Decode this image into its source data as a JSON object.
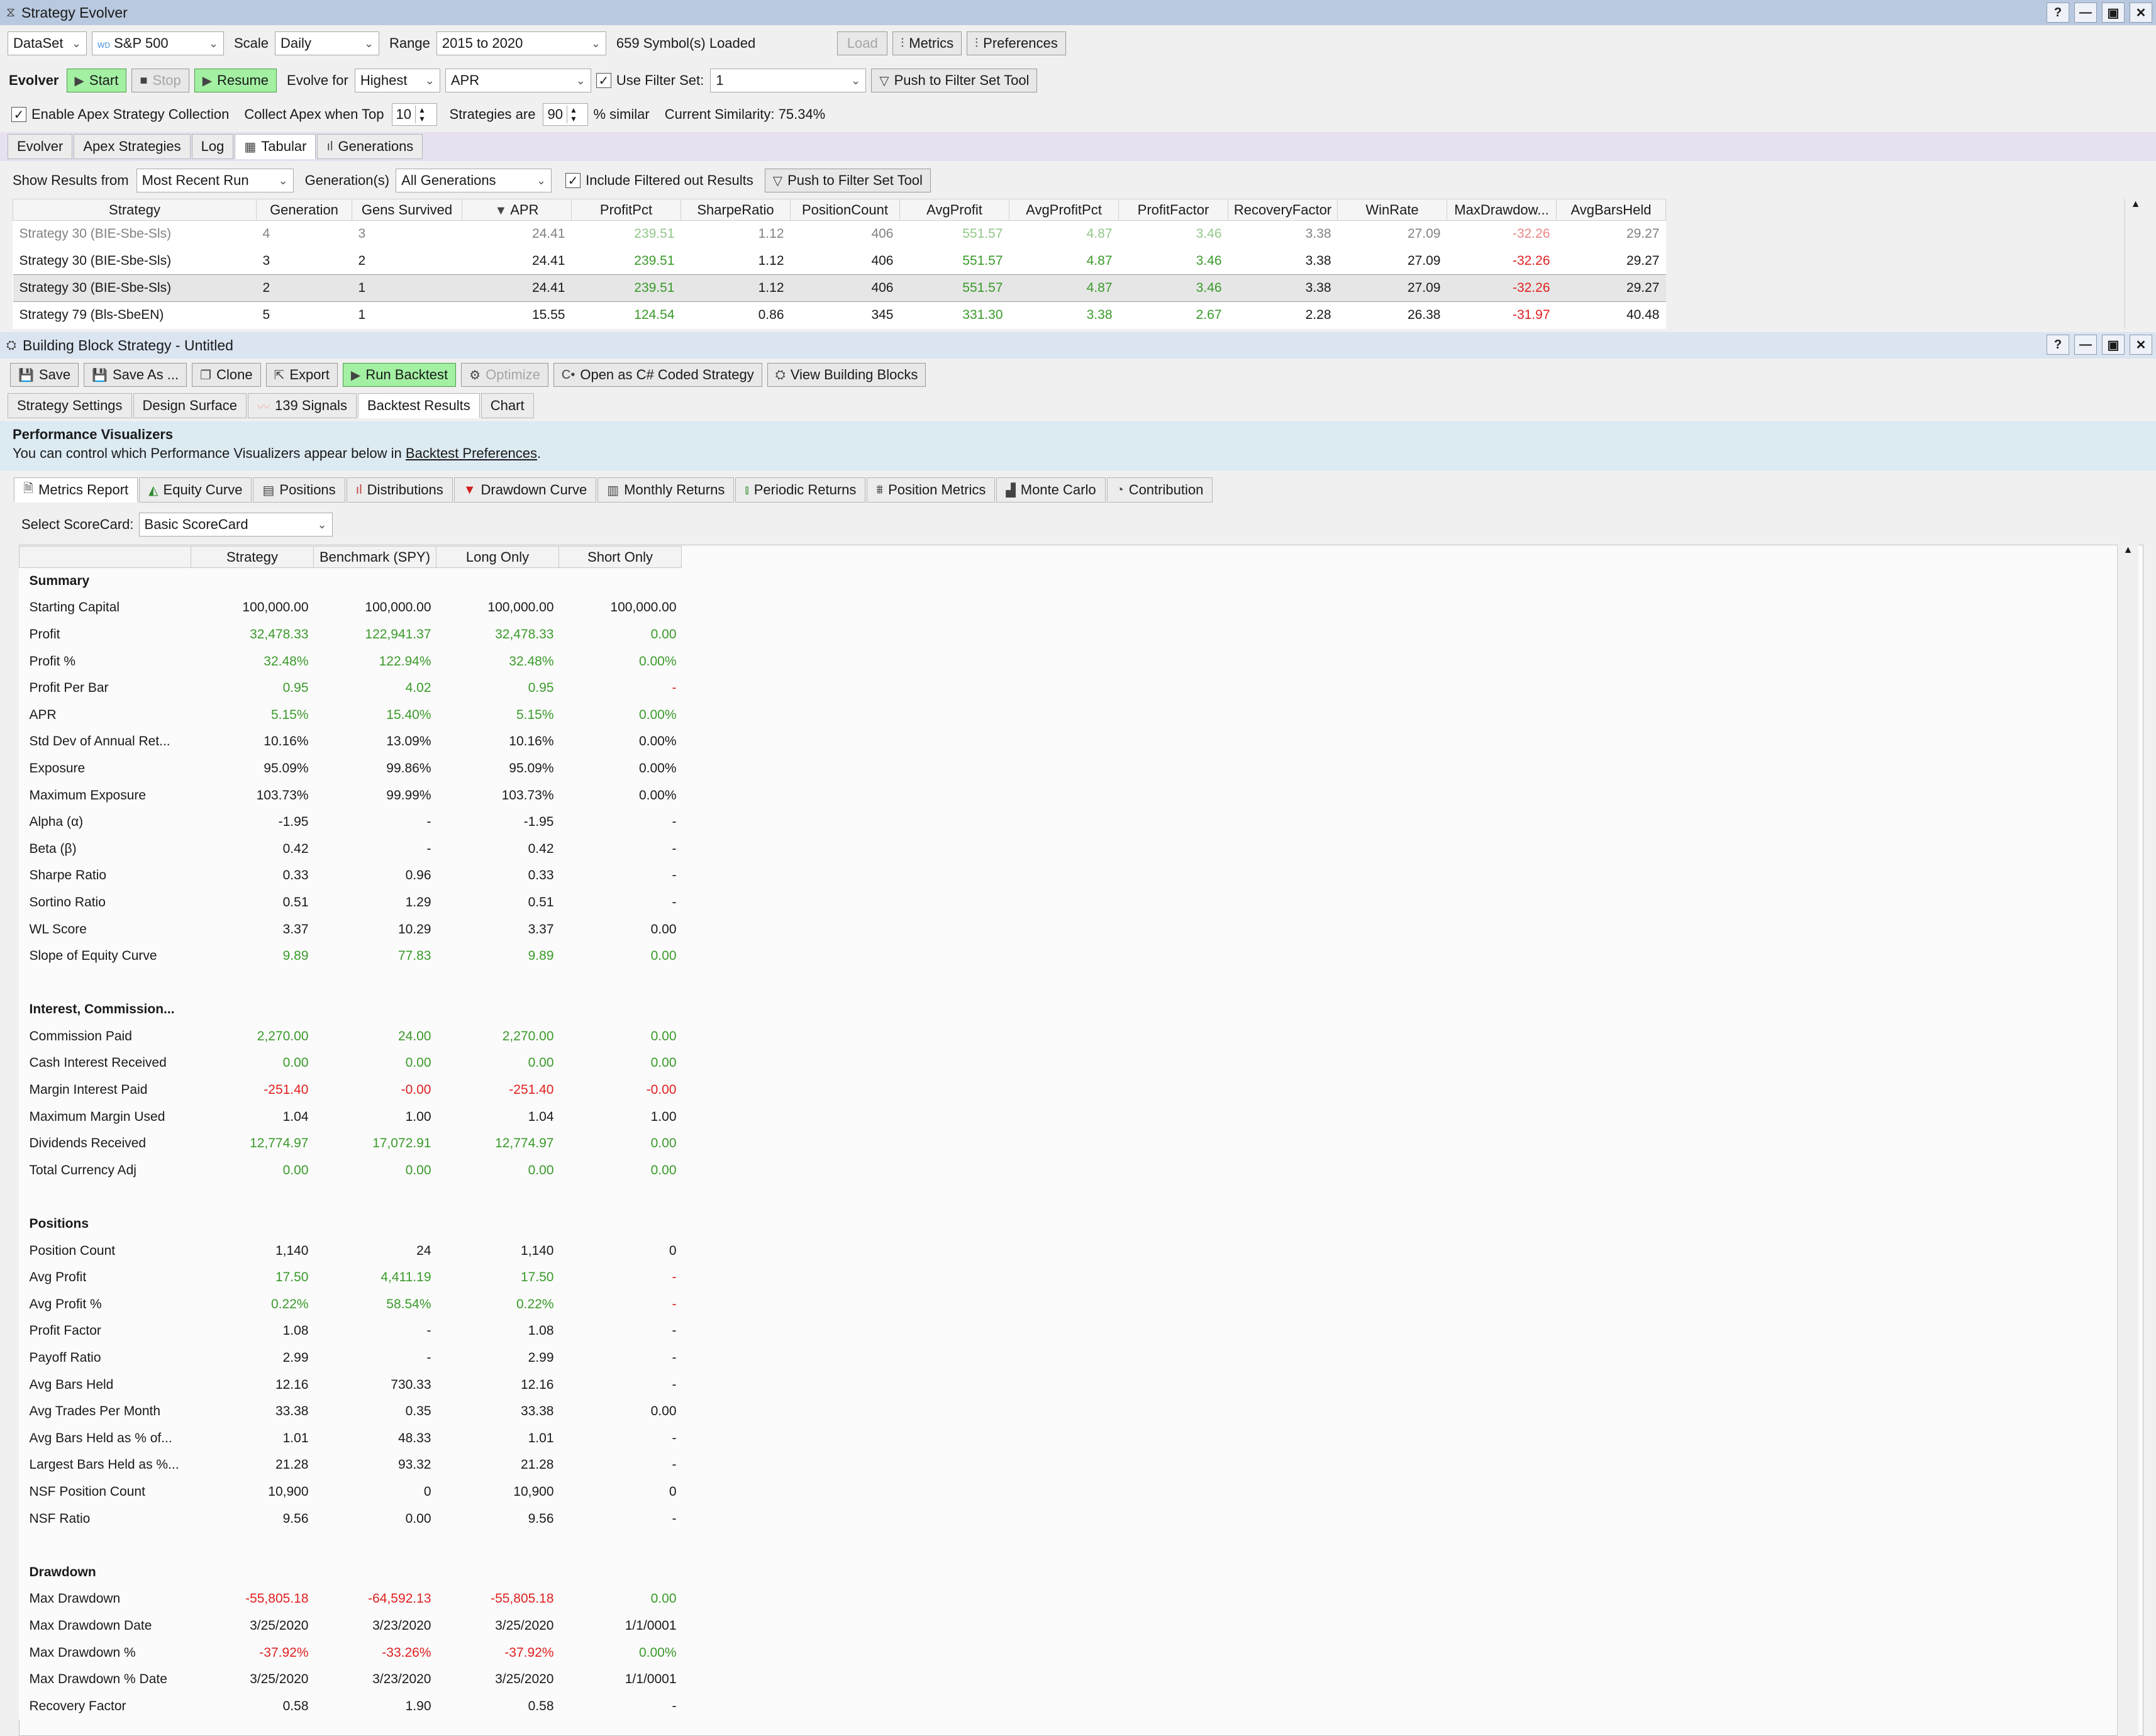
{
  "app": {
    "title": "Strategy Evolver"
  },
  "toolbar1": {
    "dataset_label": "DataSet",
    "dataset_value": "S&P 500",
    "scale_label": "Scale",
    "scale_value": "Daily",
    "range_label": "Range",
    "range_value": "2015 to 2020",
    "symbols_loaded": "659 Symbol(s) Loaded",
    "load": "Load",
    "metrics": "Metrics",
    "preferences": "Preferences"
  },
  "toolbar2": {
    "evolver": "Evolver",
    "start": "Start",
    "stop": "Stop",
    "resume": "Resume",
    "evolve_for": "Evolve for",
    "evolve_dir": "Highest",
    "evolve_metric": "APR",
    "use_filter_set": "Use Filter Set:",
    "filter_set_value": "1",
    "push": "Push to Filter Set Tool"
  },
  "toolbar3": {
    "enable_apex": "Enable Apex Strategy Collection",
    "collect_apex": "Collect Apex when Top",
    "top_value": "10",
    "strategies_are": "Strategies are",
    "similar_value": "90",
    "similar": "% similar",
    "current_similarity": "Current Similarity: 75.34%"
  },
  "evolver_tabs": [
    "Evolver",
    "Apex Strategies",
    "Log",
    "Tabular",
    "Generations"
  ],
  "results_bar": {
    "show_from": "Show Results from",
    "show_value": "Most Recent Run",
    "generations": "Generation(s)",
    "generations_value": "All Generations",
    "include_filtered": "Include Filtered out Results",
    "push": "Push to Filter Set Tool"
  },
  "grid": {
    "columns": [
      "Strategy",
      "Generation",
      "Gens Survived",
      "APR",
      "ProfitPct",
      "SharpeRatio",
      "PositionCount",
      "AvgProfit",
      "AvgProfitPct",
      "ProfitFactor",
      "RecoveryFactor",
      "WinRate",
      "MaxDrawdow...",
      "AvgBarsHeld"
    ],
    "rows": [
      [
        "Strategy 30 (BIE-Sbe-Sls)",
        "4",
        "3",
        "24.41",
        "239.51",
        "1.12",
        "406",
        "551.57",
        "4.87",
        "3.46",
        "3.38",
        "27.09",
        "-32.26",
        "29.27"
      ],
      [
        "Strategy 30 (BIE-Sbe-Sls)",
        "3",
        "2",
        "24.41",
        "239.51",
        "1.12",
        "406",
        "551.57",
        "4.87",
        "3.46",
        "3.38",
        "27.09",
        "-32.26",
        "29.27"
      ],
      [
        "Strategy 30 (BIE-Sbe-Sls)",
        "2",
        "1",
        "24.41",
        "239.51",
        "1.12",
        "406",
        "551.57",
        "4.87",
        "3.46",
        "3.38",
        "27.09",
        "-32.26",
        "29.27"
      ],
      [
        "Strategy 79 (Bls-SbeEN)",
        "5",
        "1",
        "15.55",
        "124.54",
        "0.86",
        "345",
        "331.30",
        "3.38",
        "2.67",
        "2.28",
        "26.38",
        "-31.97",
        "40.48"
      ]
    ]
  },
  "bbs": {
    "title": "Building Block Strategy - Untitled",
    "save": "Save",
    "save_as": "Save As ...",
    "clone": "Clone",
    "export": "Export",
    "run_backtest": "Run Backtest",
    "optimize": "Optimize",
    "open_csharp": "Open as C# Coded Strategy",
    "view_blocks": "View Building Blocks",
    "tabs": [
      "Strategy Settings",
      "Design Surface",
      "139 Signals",
      "Backtest Results",
      "Chart"
    ]
  },
  "perf": {
    "heading": "Performance Visualizers",
    "subtext": "You can control which Performance Visualizers appear below in",
    "link": "Backtest Preferences",
    "tabs": [
      "Metrics Report",
      "Equity Curve",
      "Positions",
      "Distributions",
      "Drawdown Curve",
      "Monthly Returns",
      "Periodic Returns",
      "Position Metrics",
      "Monte Carlo",
      "Contribution"
    ],
    "scorecard_label": "Select ScoreCard:",
    "scorecard_value": "Basic ScoreCard"
  },
  "metrics": {
    "columns": [
      "",
      "Strategy",
      "Benchmark (SPY)",
      "Long Only",
      "Short Only"
    ],
    "rows": [
      [
        "Summary",
        "",
        "",
        "",
        ""
      ],
      [
        "Starting Capital",
        "100,000.00",
        "100,000.00",
        "100,000.00",
        "100,000.00"
      ],
      [
        "Profit",
        "32,478.33",
        "122,941.37",
        "32,478.33",
        "0.00"
      ],
      [
        "Profit %",
        "32.48%",
        "122.94%",
        "32.48%",
        "0.00%"
      ],
      [
        "Profit Per Bar",
        "0.95",
        "4.02",
        "0.95",
        "-"
      ],
      [
        "APR",
        "5.15%",
        "15.40%",
        "5.15%",
        "0.00%"
      ],
      [
        "Std Dev of Annual Ret...",
        "10.16%",
        "13.09%",
        "10.16%",
        "0.00%"
      ],
      [
        "Exposure",
        "95.09%",
        "99.86%",
        "95.09%",
        "0.00%"
      ],
      [
        "Maximum Exposure",
        "103.73%",
        "99.99%",
        "103.73%",
        "0.00%"
      ],
      [
        "Alpha (α)",
        "-1.95",
        "-",
        "-1.95",
        "-"
      ],
      [
        "Beta (β)",
        "0.42",
        "-",
        "0.42",
        "-"
      ],
      [
        "Sharpe Ratio",
        "0.33",
        "0.96",
        "0.33",
        "-"
      ],
      [
        "Sortino Ratio",
        "0.51",
        "1.29",
        "0.51",
        "-"
      ],
      [
        "WL Score",
        "3.37",
        "10.29",
        "3.37",
        "0.00"
      ],
      [
        "Slope of Equity Curve",
        "9.89",
        "77.83",
        "9.89",
        "0.00"
      ],
      [
        "",
        "",
        "",
        "",
        ""
      ],
      [
        "Interest, Commission...",
        "",
        "",
        "",
        ""
      ],
      [
        "Commission Paid",
        "2,270.00",
        "24.00",
        "2,270.00",
        "0.00"
      ],
      [
        "Cash Interest Received",
        "0.00",
        "0.00",
        "0.00",
        "0.00"
      ],
      [
        "Margin Interest Paid",
        "-251.40",
        "-0.00",
        "-251.40",
        "-0.00"
      ],
      [
        "Maximum Margin Used",
        "1.04",
        "1.00",
        "1.04",
        "1.00"
      ],
      [
        "Dividends Received",
        "12,774.97",
        "17,072.91",
        "12,774.97",
        "0.00"
      ],
      [
        "Total Currency Adj",
        "0.00",
        "0.00",
        "0.00",
        "0.00"
      ],
      [
        "",
        "",
        "",
        "",
        ""
      ],
      [
        "Positions",
        "",
        "",
        "",
        ""
      ],
      [
        "Position Count",
        "1,140",
        "24",
        "1,140",
        "0"
      ],
      [
        "Avg Profit",
        "17.50",
        "4,411.19",
        "17.50",
        "-"
      ],
      [
        "Avg Profit %",
        "0.22%",
        "58.54%",
        "0.22%",
        "-"
      ],
      [
        "Profit Factor",
        "1.08",
        "-",
        "1.08",
        "-"
      ],
      [
        "Payoff Ratio",
        "2.99",
        "-",
        "2.99",
        "-"
      ],
      [
        "Avg Bars Held",
        "12.16",
        "730.33",
        "12.16",
        "-"
      ],
      [
        "Avg Trades Per Month",
        "33.38",
        "0.35",
        "33.38",
        "0.00"
      ],
      [
        "Avg Bars Held as % of...",
        "1.01",
        "48.33",
        "1.01",
        "-"
      ],
      [
        "Largest Bars Held as %...",
        "21.28",
        "93.32",
        "21.28",
        "-"
      ],
      [
        "NSF Position Count",
        "10,900",
        "0",
        "10,900",
        "0"
      ],
      [
        "NSF Ratio",
        "9.56",
        "0.00",
        "9.56",
        "-"
      ],
      [
        "",
        "",
        "",
        "",
        ""
      ],
      [
        "Drawdown",
        "",
        "",
        "",
        ""
      ],
      [
        "Max Drawdown",
        "-55,805.18",
        "-64,592.13",
        "-55,805.18",
        "0.00"
      ],
      [
        "Max Drawdown Date",
        "3/25/2020",
        "3/23/2020",
        "3/25/2020",
        "1/1/0001"
      ],
      [
        "Max Drawdown %",
        "-37.92%",
        "-33.26%",
        "-37.92%",
        "0.00%"
      ],
      [
        "Max Drawdown % Date",
        "3/25/2020",
        "3/23/2020",
        "3/25/2020",
        "1/1/0001"
      ],
      [
        "Recovery Factor",
        "0.58",
        "1.90",
        "0.58",
        "-"
      ]
    ]
  },
  "colors": {
    "positive": "#3a9a2a",
    "negative": "#e02020",
    "title_bar": "#b9c9df",
    "run_button": "#a3f0a3"
  }
}
